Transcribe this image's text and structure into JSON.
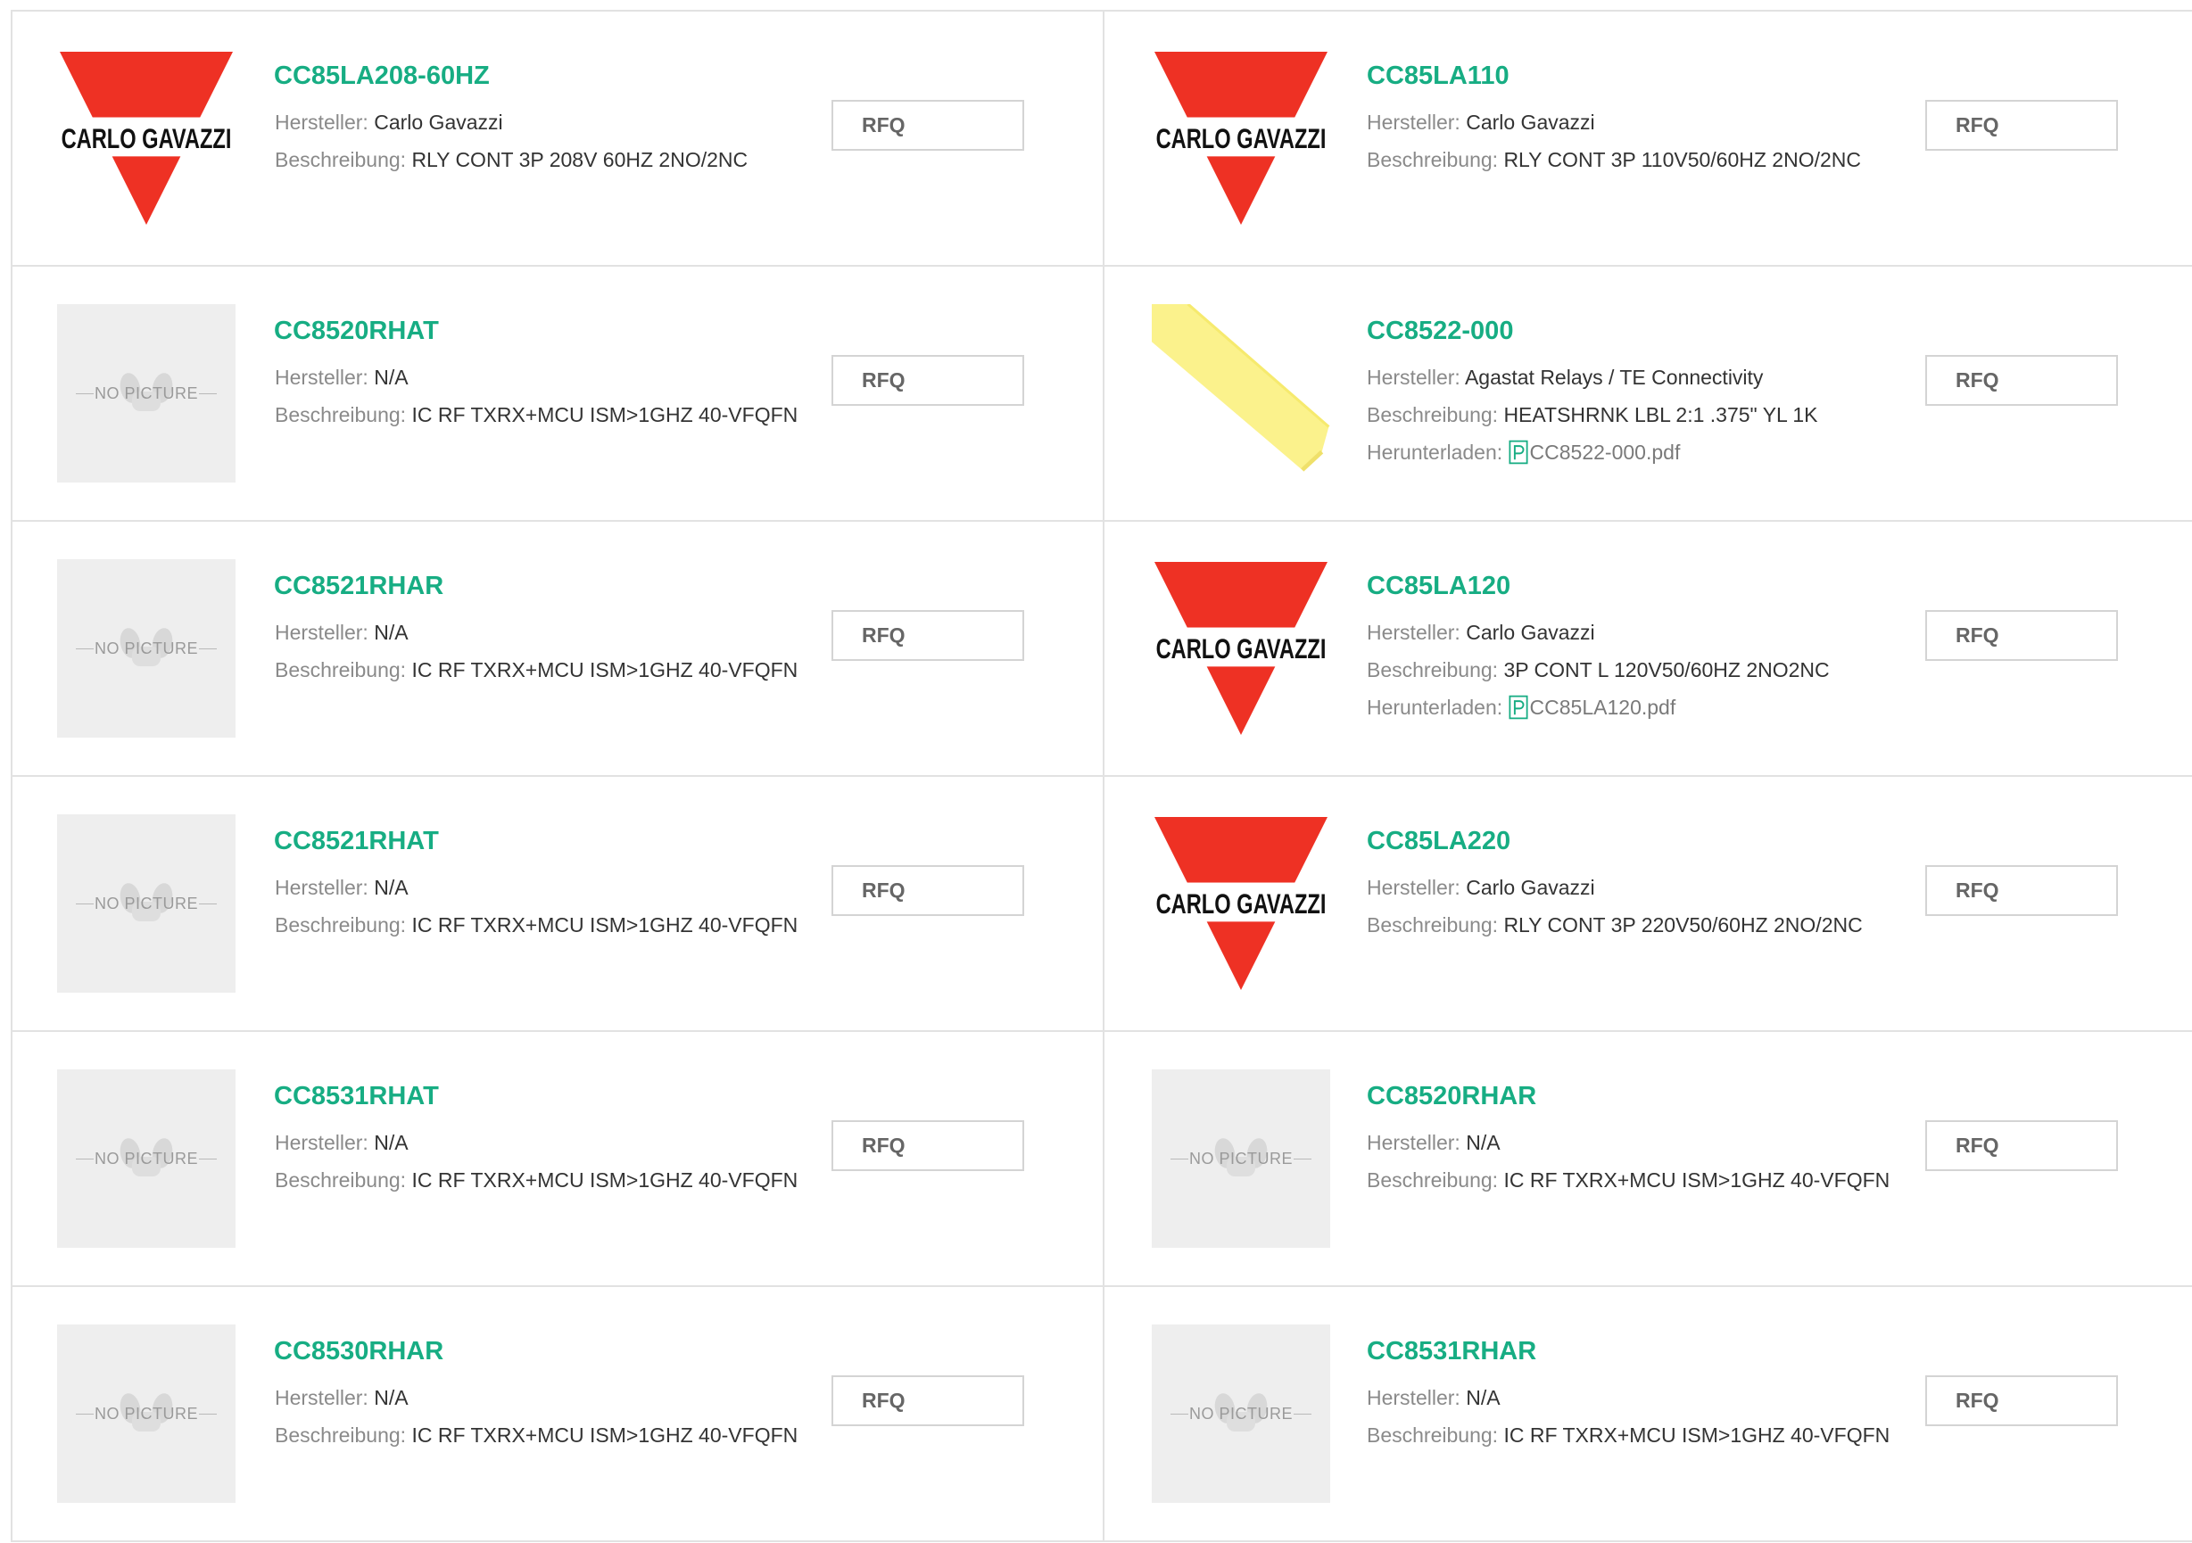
{
  "labels": {
    "manufacturer": "Hersteller:",
    "description": "Beschreibung:",
    "download": "Herunterladen:",
    "rfq": "RFQ",
    "no_picture": "NO PICTURE"
  },
  "logo_text": "CARLO GAVAZZI",
  "colors": {
    "title": "#17ad83",
    "brand_red": "#ee3124",
    "heatshrink_yellow": "#fbf28c"
  },
  "products": [
    {
      "part": "CC85LA208-60HZ",
      "manufacturer": "Carlo Gavazzi",
      "description": "RLY CONT 3P 208V 60HZ 2NO/2NC",
      "image": "carlo-gavazzi-logo"
    },
    {
      "part": "CC85LA110",
      "manufacturer": "Carlo Gavazzi",
      "description": "RLY CONT 3P 110V50/60HZ 2NO/2NC",
      "image": "carlo-gavazzi-logo"
    },
    {
      "part": "CC8520RHAT",
      "manufacturer": "N/A",
      "description": "IC RF TXRX+MCU ISM>1GHZ 40-VFQFN",
      "image": "no-picture"
    },
    {
      "part": "CC8522-000",
      "manufacturer": "Agastat Relays / TE Connectivity",
      "description": "HEATSHRNK LBL 2:1 .375\" YL 1K",
      "image": "yellow-heatshrink",
      "download": "CC8522-000.pdf"
    },
    {
      "part": "CC8521RHAR",
      "manufacturer": "N/A",
      "description": "IC RF TXRX+MCU ISM>1GHZ 40-VFQFN",
      "image": "no-picture"
    },
    {
      "part": "CC85LA120",
      "manufacturer": "Carlo Gavazzi",
      "description": "3P CONT L 120V50/60HZ 2NO2NC",
      "image": "carlo-gavazzi-logo",
      "download": "CC85LA120.pdf"
    },
    {
      "part": "CC8521RHAT",
      "manufacturer": "N/A",
      "description": "IC RF TXRX+MCU ISM>1GHZ 40-VFQFN",
      "image": "no-picture"
    },
    {
      "part": "CC85LA220",
      "manufacturer": "Carlo Gavazzi",
      "description": "RLY CONT 3P 220V50/60HZ 2NO/2NC",
      "image": "carlo-gavazzi-logo"
    },
    {
      "part": "CC8531RHAT",
      "manufacturer": "N/A",
      "description": "IC RF TXRX+MCU ISM>1GHZ 40-VFQFN",
      "image": "no-picture"
    },
    {
      "part": "CC8520RHAR",
      "manufacturer": "N/A",
      "description": "IC RF TXRX+MCU ISM>1GHZ 40-VFQFN",
      "image": "no-picture"
    },
    {
      "part": "CC8530RHAR",
      "manufacturer": "N/A",
      "description": "IC RF TXRX+MCU ISM>1GHZ 40-VFQFN",
      "image": "no-picture"
    },
    {
      "part": "CC8531RHAR",
      "manufacturer": "N/A",
      "description": "IC RF TXRX+MCU ISM>1GHZ 40-VFQFN",
      "image": "no-picture"
    }
  ]
}
